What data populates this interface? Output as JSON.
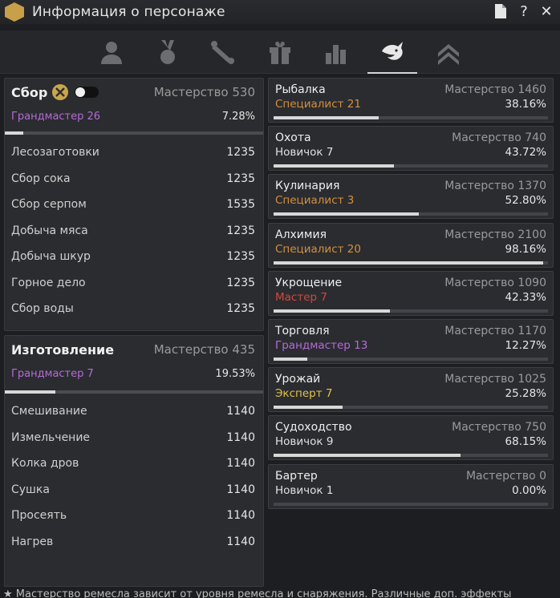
{
  "window": {
    "title": "Информация о персонаже"
  },
  "tabs": [
    {
      "icon": "person-icon"
    },
    {
      "icon": "medal-icon"
    },
    {
      "icon": "scroll-icon"
    },
    {
      "icon": "gift-icon"
    },
    {
      "icon": "bar-chart-icon"
    },
    {
      "icon": "life-skill-icon",
      "active": true
    },
    {
      "icon": "rank-up-icon"
    }
  ],
  "gathering": {
    "title": "Сбор",
    "mastery": "Мастерство 530",
    "grade": "Грандмастер 26",
    "percent": "7.28%",
    "progress": 0.0728,
    "items": [
      {
        "name": "Лесозаготовки",
        "value": "1235"
      },
      {
        "name": "Сбор сока",
        "value": "1235"
      },
      {
        "name": "Сбор серпом",
        "value": "1535"
      },
      {
        "name": "Добыча мяса",
        "value": "1235"
      },
      {
        "name": "Добыча шкур",
        "value": "1235"
      },
      {
        "name": "Горное дело",
        "value": "1235"
      },
      {
        "name": "Сбор воды",
        "value": "1235"
      }
    ]
  },
  "crafting": {
    "title": "Изготовление",
    "mastery": "Мастерство 435",
    "grade": "Грандмастер 7",
    "percent": "19.53%",
    "progress": 0.1953,
    "items": [
      {
        "name": "Смешивание",
        "value": "1140"
      },
      {
        "name": "Измельчение",
        "value": "1140"
      },
      {
        "name": "Колка дров",
        "value": "1140"
      },
      {
        "name": "Сушка",
        "value": "1140"
      },
      {
        "name": "Просеять",
        "value": "1140"
      },
      {
        "name": "Нагрев",
        "value": "1140"
      }
    ]
  },
  "skills": [
    {
      "name": "Рыбалка",
      "mastery": "Мастерство 1460",
      "grade": "Специалист 21",
      "grade_class": "g-spec",
      "percent": "38.16%",
      "progress": 0.3816
    },
    {
      "name": "Охота",
      "mastery": "Мастерство 740",
      "grade": "Новичок 7",
      "grade_class": "g-nov",
      "percent": "43.72%",
      "progress": 0.4372
    },
    {
      "name": "Кулинария",
      "mastery": "Мастерство 1370",
      "grade": "Специалист 3",
      "grade_class": "g-spec",
      "percent": "52.80%",
      "progress": 0.528
    },
    {
      "name": "Алхимия",
      "mastery": "Мастерство 2100",
      "grade": "Специалист 20",
      "grade_class": "g-spec",
      "percent": "98.16%",
      "progress": 0.9816
    },
    {
      "name": "Укрощение",
      "mastery": "Мастерство 1090",
      "grade": "Мастер 7",
      "grade_class": "g-master",
      "percent": "42.33%",
      "progress": 0.4233
    },
    {
      "name": "Торговля",
      "mastery": "Мастерство 1170",
      "grade": "Грандмастер 13",
      "grade_class": "g-gm",
      "percent": "12.27%",
      "progress": 0.1227
    },
    {
      "name": "Урожай",
      "mastery": "Мастерство 1025",
      "grade": "Эксперт 7",
      "grade_class": "g-exp",
      "percent": "25.28%",
      "progress": 0.2528
    },
    {
      "name": "Судоходство",
      "mastery": "Мастерство 750",
      "grade": "Новичок 9",
      "grade_class": "g-nov",
      "percent": "68.15%",
      "progress": 0.6815
    },
    {
      "name": "Бартер",
      "mastery": "Мастерство 0",
      "grade": "Новичок 1",
      "grade_class": "g-nov",
      "percent": "0.00%",
      "progress": 0
    }
  ],
  "footnote": "★ Мастерство ремесла зависит от уровня ремесла и снаряжения. Различные доп. эффекты"
}
